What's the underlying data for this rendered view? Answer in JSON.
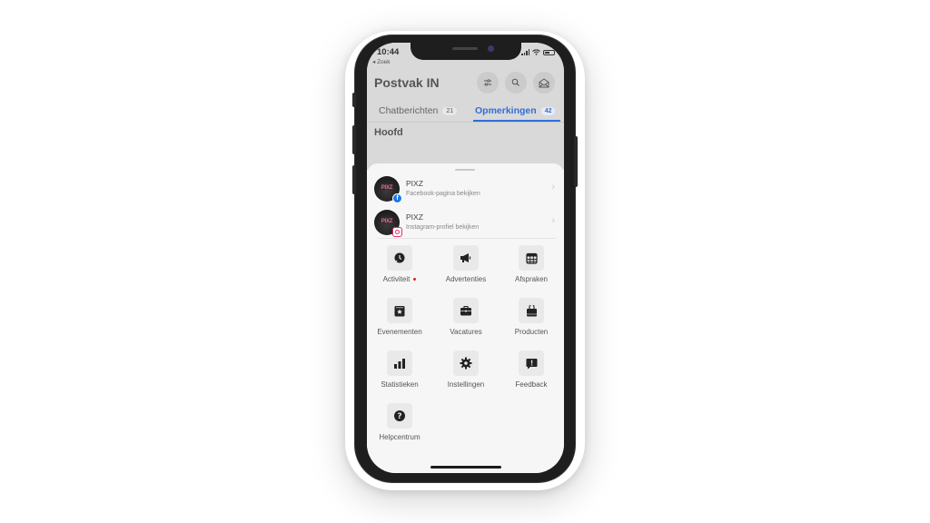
{
  "status_bar": {
    "time": "10:44",
    "back_label": "◂ Zoek"
  },
  "header": {
    "title": "Postvak IN",
    "buttons": [
      {
        "name": "filter",
        "icon": "sliders-icon"
      },
      {
        "name": "search",
        "icon": "search-icon"
      },
      {
        "name": "mark-read",
        "icon": "envelope-open-icon"
      }
    ]
  },
  "tabs": [
    {
      "label": "Chatberichten",
      "count": "21",
      "active": false
    },
    {
      "label": "Opmerkingen",
      "count": "42",
      "active": true
    }
  ],
  "section_title": "Hoofd",
  "accent_color": "#2f6fd9",
  "sheet": {
    "pages": [
      {
        "name": "PIXZ",
        "subtitle": "Facebook-pagina bekijken",
        "platform": "facebook"
      },
      {
        "name": "PIXZ",
        "subtitle": "Instagram-profiel bekijken",
        "platform": "instagram"
      }
    ],
    "avatar_text": "PIXZ",
    "grid": [
      {
        "label": "Activiteit",
        "icon": "activity-clock-icon",
        "notification_dot": true
      },
      {
        "label": "Advertenties",
        "icon": "megaphone-icon"
      },
      {
        "label": "Afspraken",
        "icon": "calendar-icon"
      },
      {
        "label": "Evenementen",
        "icon": "event-star-icon"
      },
      {
        "label": "Vacatures",
        "icon": "briefcase-icon"
      },
      {
        "label": "Producten",
        "icon": "shopping-bag-icon"
      },
      {
        "label": "Statistieken",
        "icon": "bar-chart-icon"
      },
      {
        "label": "Instellingen",
        "icon": "gear-icon"
      },
      {
        "label": "Feedback",
        "icon": "feedback-icon"
      },
      {
        "label": "Helpcentrum",
        "icon": "help-icon"
      }
    ]
  }
}
